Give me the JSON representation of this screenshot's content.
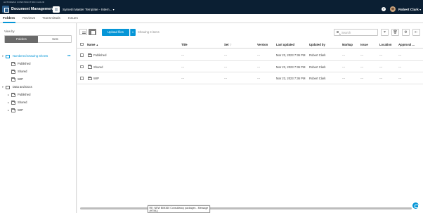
{
  "brandbar": {
    "text": "AUTODESK CONSTRUCTION CLOUD"
  },
  "topbar": {
    "app_title": "Document Management",
    "app_caret": "▾",
    "project_title": "Symetri Master Template - Intern...",
    "project_caret": "▾",
    "help_glyph": "?",
    "user_name": "Robert Clark",
    "user_caret": "▾"
  },
  "tabs": [
    {
      "label": "Folders",
      "active": true
    },
    {
      "label": "Reviews",
      "active": false
    },
    {
      "label": "Transmittals",
      "active": false
    },
    {
      "label": "Issues",
      "active": false
    }
  ],
  "sidebar": {
    "view_by_label": "View by",
    "toggle_folders": "Folders",
    "toggle_sets": "Sets",
    "tree": [
      {
        "label": "Numbered Drawing Sheets",
        "level": 0,
        "selected": true,
        "expanded": true,
        "icon": "project-icon"
      },
      {
        "label": "Published",
        "level": 1,
        "icon": "folder-icon"
      },
      {
        "label": "Shared",
        "level": 1,
        "icon": "folder-icon"
      },
      {
        "label": "WIP",
        "level": 1,
        "icon": "folder-icon"
      },
      {
        "label": "Data and Docs",
        "level": 0,
        "selected": false,
        "expanded": true,
        "icon": "project-icon"
      },
      {
        "label": "Published",
        "level": 1,
        "icon": "folder-icon",
        "collapsed_caret": true
      },
      {
        "label": "Shared",
        "level": 1,
        "icon": "folder-icon",
        "collapsed_caret": true
      },
      {
        "label": "WIP",
        "level": 1,
        "icon": "folder-icon",
        "collapsed_caret": true
      }
    ],
    "more_glyph": "•••"
  },
  "toolbar": {
    "upload_label": "Upload files",
    "upload_caret": "▾",
    "showing_text": "Showing 3 items",
    "search_placeholder": "Search"
  },
  "table": {
    "columns": [
      "Name",
      "Title",
      "Set",
      "Version",
      "Last updated",
      "Updated by",
      "Markup",
      "Issue",
      "Location",
      "Approval ..."
    ],
    "sort_glyph": "▲",
    "filter_glyph": "▽",
    "rows": [
      {
        "name": "Published",
        "title": "---",
        "set": "---",
        "version": "---",
        "last_updated": "Mar 23, 2023 7:36 PM",
        "updated_by": "Robert Clark",
        "markup": "---",
        "issue": "---",
        "location": "---",
        "approval": "---"
      },
      {
        "name": "Shared",
        "title": "---",
        "set": "---",
        "version": "---",
        "last_updated": "Mar 23, 2023 7:36 PM",
        "updated_by": "Robert Clark",
        "markup": "---",
        "issue": "---",
        "location": "---",
        "approval": "---"
      },
      {
        "name": "WIP",
        "title": "---",
        "set": "---",
        "version": "---",
        "last_updated": "Mar 23, 2023 7:36 PM",
        "updated_by": "Robert Clark",
        "markup": "---",
        "issue": "---",
        "location": "---",
        "approval": "---"
      }
    ]
  },
  "tooltip": {
    "text": "RE: NEW BIM360 Consultancy packages - Message (HTML)"
  },
  "colors": {
    "accent": "#0696d7",
    "topbar": "#0b1f33"
  }
}
